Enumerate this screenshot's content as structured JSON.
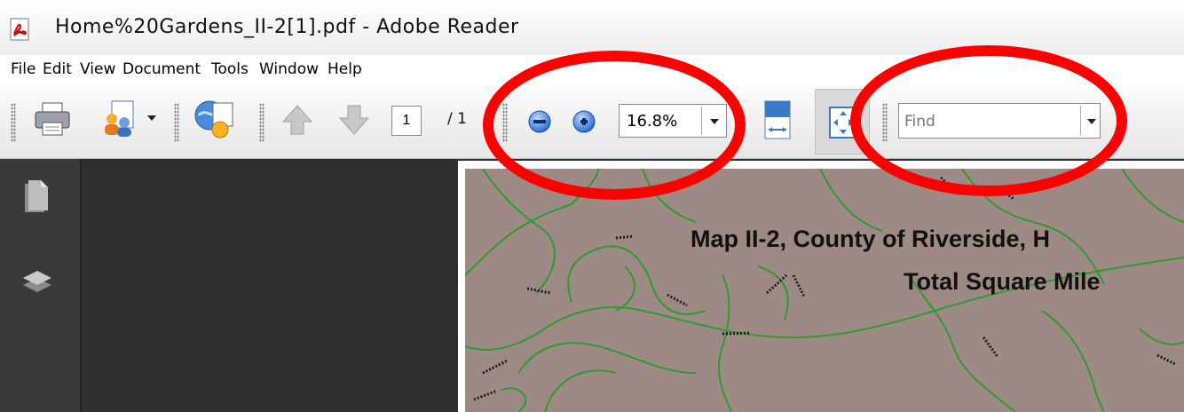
{
  "window": {
    "title": "Home%20Gardens_II-2[1].pdf - Adobe Reader",
    "icon": "pdf-icon"
  },
  "menu": [
    "File",
    "Edit",
    "View",
    "Document",
    "Tools",
    "Window",
    "Help"
  ],
  "toolbar": {
    "current_page": "1",
    "page_total": "/ 1",
    "zoom": "16.8%",
    "find_placeholder": "Find",
    "icons": [
      "print-icon",
      "collaborate-icon",
      "secure-icon",
      "prev-page-icon",
      "next-page-icon",
      "zoom-out-icon",
      "zoom-in-icon",
      "fit-width-icon",
      "full-screen-icon"
    ]
  },
  "left_nav": {
    "icons": [
      "pages-icon",
      "layers-icon"
    ]
  },
  "document": {
    "map_title": "Map II-2, County of Riverside, H",
    "map_subtitle": "Total Square Mile"
  },
  "annotations": {
    "color": "#ff0000"
  },
  "colors": {
    "map_background": "#9e8a84",
    "roads": "#2f9a2f",
    "dark_panel": "#2f2f2f"
  }
}
